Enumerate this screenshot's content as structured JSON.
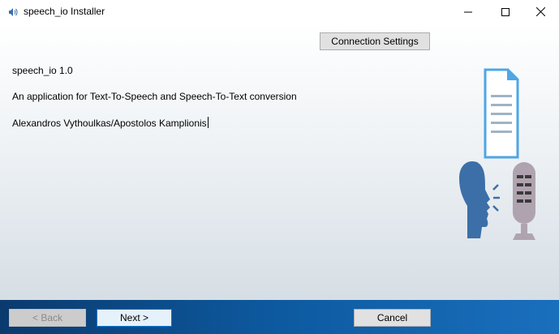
{
  "window": {
    "title": "speech_io Installer",
    "app_icon": "speaker-icon",
    "controls": {
      "minimize_icon": "minimize-icon",
      "maximize_icon": "maximize-icon",
      "close_icon": "close-icon"
    }
  },
  "toolbar": {
    "connection_settings_label": "Connection Settings"
  },
  "info": {
    "version": "speech_io 1.0",
    "description": "An application for Text-To-Speech and Speech-To-Text conversion",
    "authors": "Alexandros Vythoulkas/Apostolos Kamplionis"
  },
  "illustration": {
    "icons": [
      "document-icon",
      "speaking-head-icon",
      "microphone-icon"
    ]
  },
  "footer": {
    "back_label": "< Back",
    "next_label": "Next >",
    "cancel_label": "Cancel"
  },
  "colors": {
    "accent": "#0078d7",
    "footer_dark": "#0b3a6e",
    "footer_light": "#1a6fbd",
    "illustration_blue": "#3c6fa8",
    "document_blue": "#4ea6e6",
    "mic_gray": "#b0a3b0"
  }
}
